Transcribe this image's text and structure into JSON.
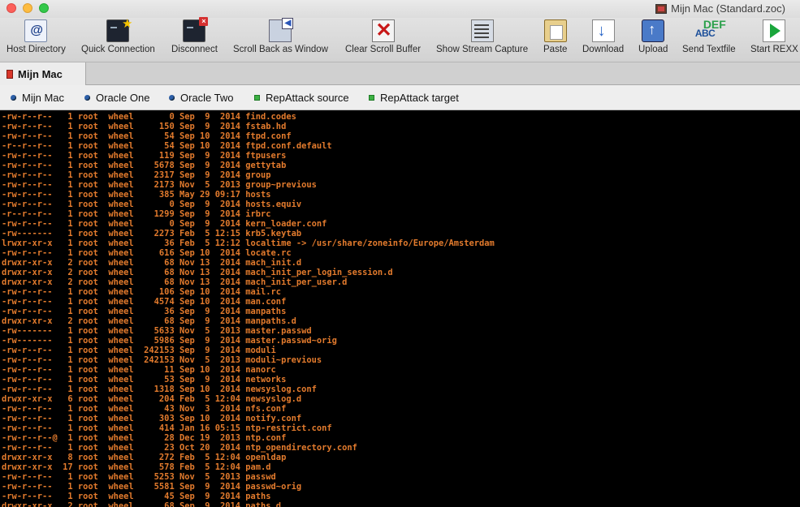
{
  "window": {
    "title": "Mijn Mac (Standard.zoc)"
  },
  "toolbar": {
    "buttons": [
      {
        "label": "Host Directory",
        "icon": "host-directory-icon"
      },
      {
        "label": "Quick Connection",
        "icon": "quick-connection-icon"
      },
      {
        "label": "Disconnect",
        "icon": "disconnect-icon"
      },
      {
        "label": "Scroll Back as Window",
        "icon": "scroll-back-icon"
      },
      {
        "label": "Clear Scroll Buffer",
        "icon": "clear-scroll-icon"
      },
      {
        "label": "Show Stream Capture",
        "icon": "stream-capture-icon"
      },
      {
        "label": "Paste",
        "icon": "paste-icon"
      },
      {
        "label": "Download",
        "icon": "download-icon"
      },
      {
        "label": "Upload",
        "icon": "upload-icon"
      },
      {
        "label": "Send Textfile",
        "icon": "send-textfile-icon"
      },
      {
        "label": "Start REXX",
        "icon": "start-rexx-icon"
      }
    ],
    "abc_text": "ABC",
    "def_text": "DEF"
  },
  "tabs": [
    {
      "label": "Mijn Mac",
      "active": true
    }
  ],
  "favorites": [
    {
      "label": "Mijn Mac",
      "kind": "host-dot"
    },
    {
      "label": "Oracle One",
      "kind": "host-dot"
    },
    {
      "label": "Oracle Two",
      "kind": "host-dot"
    },
    {
      "label": "RepAttack source",
      "kind": "green-square"
    },
    {
      "label": "RepAttack target",
      "kind": "green-square"
    }
  ],
  "colors": {
    "terminal_bg": "#000000",
    "terminal_fg": "#e37b2d"
  },
  "terminal": {
    "lines": [
      "-rw-r--r--   1 root  wheel       0 Sep  9  2014 find.codes",
      "-rw-r--r--   1 root  wheel     150 Sep  9  2014 fstab.hd",
      "-rw-r--r--   1 root  wheel      54 Sep 10  2014 ftpd.conf",
      "-r--r--r--   1 root  wheel      54 Sep 10  2014 ftpd.conf.default",
      "-rw-r--r--   1 root  wheel     119 Sep  9  2014 ftpusers",
      "-rw-r--r--   1 root  wheel    5678 Sep  9  2014 gettytab",
      "-rw-r--r--   1 root  wheel    2317 Sep  9  2014 group",
      "-rw-r--r--   1 root  wheel    2173 Nov  5  2013 group~previous",
      "-rw-r--r--   1 root  wheel     385 May 29 09:17 hosts",
      "-rw-r--r--   1 root  wheel       0 Sep  9  2014 hosts.equiv",
      "-r--r--r--   1 root  wheel    1299 Sep  9  2014 irbrc",
      "-rw-r--r--   1 root  wheel       0 Sep  9  2014 kern_loader.conf",
      "-rw-------   1 root  wheel    2273 Feb  5 12:15 krb5.keytab",
      "lrwxr-xr-x   1 root  wheel      36 Feb  5 12:12 localtime -> /usr/share/zoneinfo/Europe/Amsterdam",
      "-rw-r--r--   1 root  wheel     616 Sep 10  2014 locate.rc",
      "drwxr-xr-x   2 root  wheel      68 Nov 13  2014 mach_init.d",
      "drwxr-xr-x   2 root  wheel      68 Nov 13  2014 mach_init_per_login_session.d",
      "drwxr-xr-x   2 root  wheel      68 Nov 13  2014 mach_init_per_user.d",
      "-rw-r--r--   1 root  wheel     106 Sep 10  2014 mail.rc",
      "-rw-r--r--   1 root  wheel    4574 Sep 10  2014 man.conf",
      "-rw-r--r--   1 root  wheel      36 Sep  9  2014 manpaths",
      "drwxr-xr-x   2 root  wheel      68 Sep  9  2014 manpaths.d",
      "-rw-------   1 root  wheel    5633 Nov  5  2013 master.passwd",
      "-rw-------   1 root  wheel    5986 Sep  9  2014 master.passwd~orig",
      "-rw-r--r--   1 root  wheel  242153 Sep  9  2014 moduli",
      "-rw-r--r--   1 root  wheel  242153 Nov  5  2013 moduli~previous",
      "-rw-r--r--   1 root  wheel      11 Sep 10  2014 nanorc",
      "-rw-r--r--   1 root  wheel      53 Sep  9  2014 networks",
      "-rw-r--r--   1 root  wheel    1318 Sep 10  2014 newsyslog.conf",
      "drwxr-xr-x   6 root  wheel     204 Feb  5 12:04 newsyslog.d",
      "-rw-r--r--   1 root  wheel      43 Nov  3  2014 nfs.conf",
      "-rw-r--r--   1 root  wheel     303 Sep 10  2014 notify.conf",
      "-rw-r--r--   1 root  wheel     414 Jan 16 05:15 ntp-restrict.conf",
      "-rw-r--r--@  1 root  wheel      28 Dec 19  2013 ntp.conf",
      "-rw-r--r--   1 root  wheel      23 Oct 20  2014 ntp_opendirectory.conf",
      "drwxr-xr-x   8 root  wheel     272 Feb  5 12:04 openldap",
      "drwxr-xr-x  17 root  wheel     578 Feb  5 12:04 pam.d",
      "-rw-r--r--   1 root  wheel    5253 Nov  5  2013 passwd",
      "-rw-r--r--   1 root  wheel    5581 Sep  9  2014 passwd~orig",
      "-rw-r--r--   1 root  wheel      45 Sep  9  2014 paths",
      "drwxr-xr-x   2 root  wheel      68 Sep  9  2014 paths.d"
    ]
  }
}
